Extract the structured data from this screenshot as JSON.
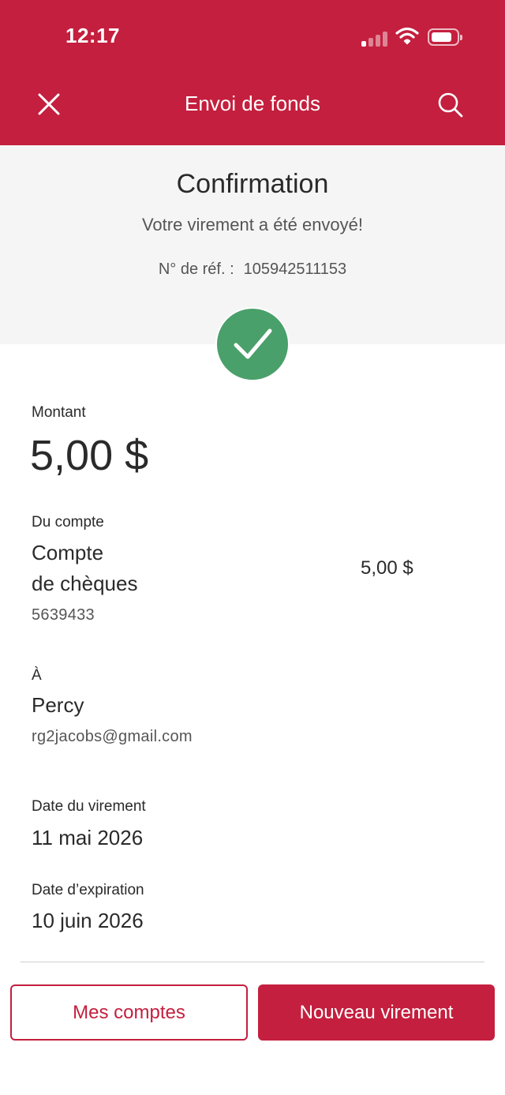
{
  "status_bar": {
    "time": "12:17"
  },
  "nav": {
    "title": "Envoi de fonds",
    "close_icon": "close-icon",
    "search_icon": "search-icon"
  },
  "confirmation": {
    "title": "Confirmation",
    "message": "Votre virement a été envoyé!",
    "ref_label": "N° de réf. :",
    "ref_number": "105942511153",
    "status_icon": "check-icon",
    "status_color": "#4aa06a"
  },
  "details": {
    "amount": {
      "label": "Montant",
      "value": "5,00 $"
    },
    "from": {
      "label": "Du compte",
      "account_name_line1": "Compte",
      "account_name_line2": "de chèques",
      "account_number": "5639433",
      "amount": "5,00 $"
    },
    "to": {
      "label": "À",
      "name": "Percy",
      "email": "rg2jacobs@gmail.com"
    },
    "transfer_date": {
      "label": "Date du virement",
      "value": "11 mai 2026"
    },
    "expiry_date": {
      "label": "Date d’expiration",
      "value": "10 juin 2026"
    }
  },
  "actions": {
    "secondary": "Mes comptes",
    "primary": "Nouveau virement"
  },
  "colors": {
    "brand": "#c41f3e",
    "success": "#4aa06a",
    "panel": "#f5f5f5"
  }
}
